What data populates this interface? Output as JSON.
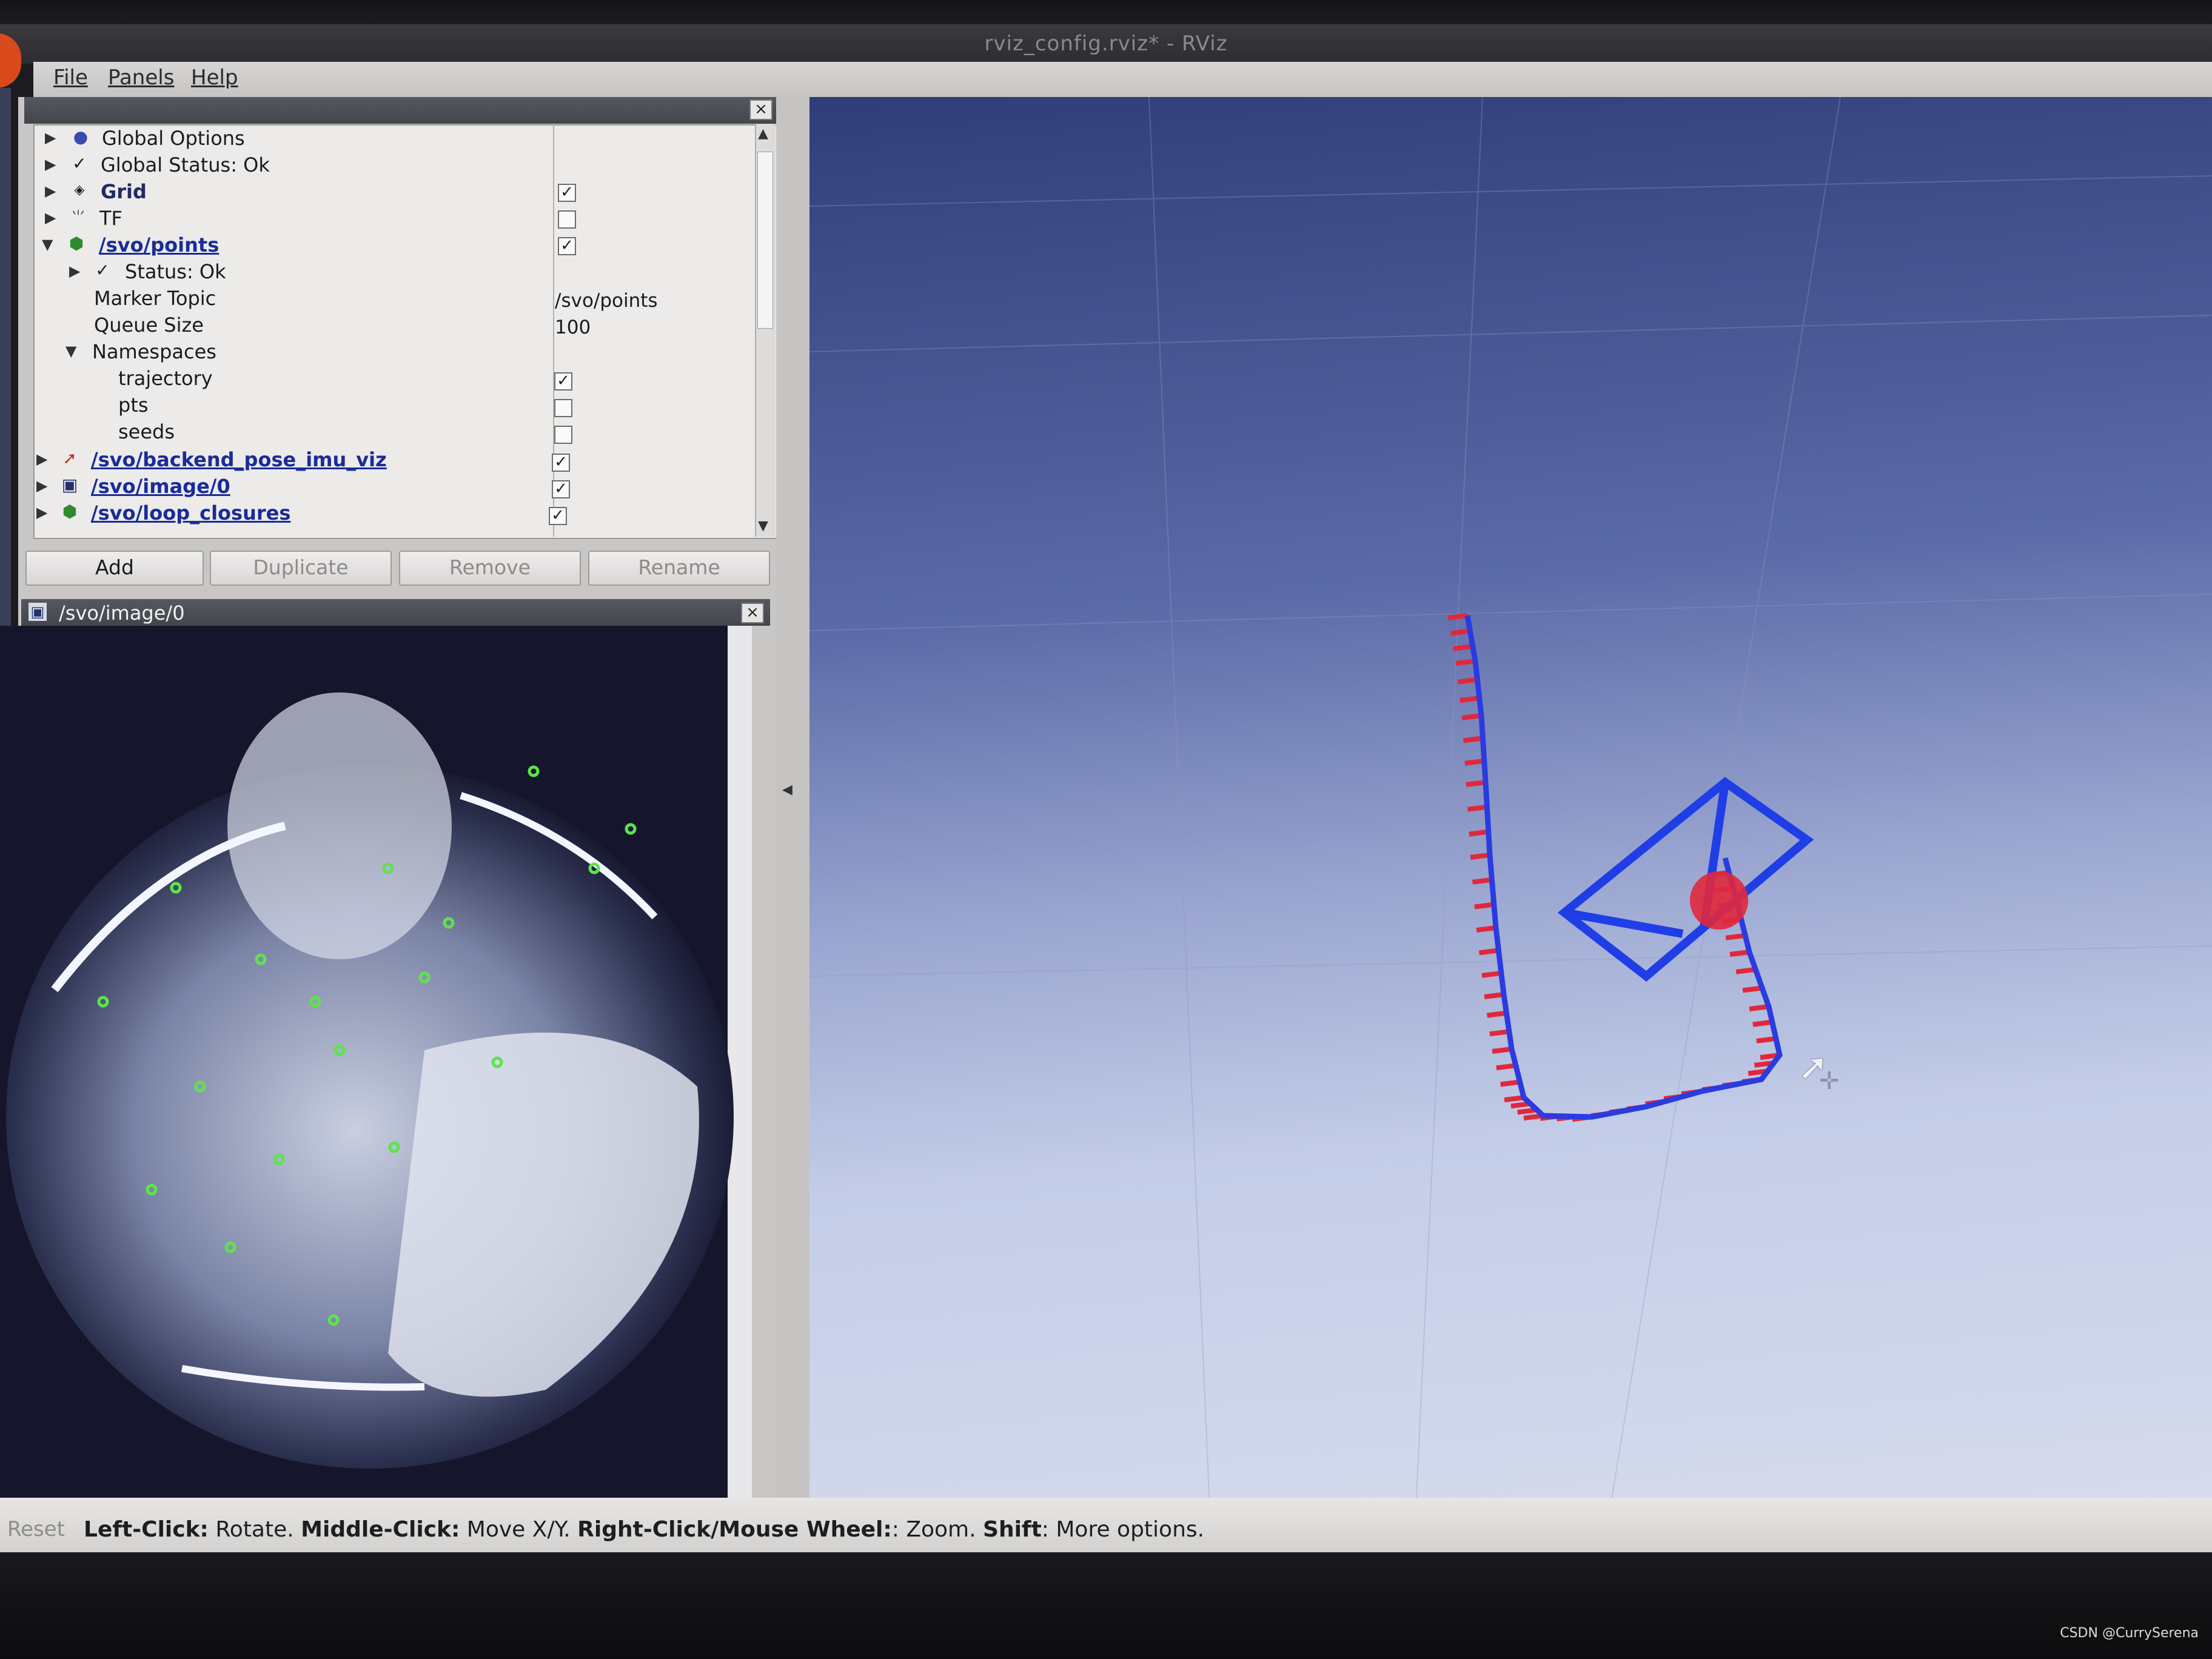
{
  "window": {
    "title": "rviz_config.rviz* - RViz"
  },
  "menubar": {
    "items": [
      "File",
      "Panels",
      "Help"
    ]
  },
  "displays_panel": {
    "close_glyph": "×",
    "rows": [
      {
        "label": "Global Options",
        "icon": "globe-icon",
        "kind": "normal"
      },
      {
        "label": "Global Status: Ok",
        "icon": "check-icon",
        "kind": "normal"
      },
      {
        "label": "Grid",
        "icon": "grid-icon",
        "kind": "bold",
        "checked": true
      },
      {
        "label": "TF",
        "icon": "tf-icon",
        "kind": "normal",
        "checked": false
      },
      {
        "label": "/svo/points",
        "icon": "marker-cube-icon",
        "kind": "topic",
        "checked": true
      },
      {
        "label": "Status: Ok",
        "icon": "check-icon",
        "kind": "normal"
      },
      {
        "label": "Marker Topic",
        "value": "/svo/points"
      },
      {
        "label": "Queue Size",
        "value": "100"
      },
      {
        "label": "Namespaces"
      },
      {
        "label": "trajectory",
        "checked": true
      },
      {
        "label": "pts",
        "checked": false
      },
      {
        "label": "seeds",
        "checked": false
      },
      {
        "label": "/svo/backend_pose_imu_viz",
        "icon": "pose-arrow-icon",
        "kind": "topic",
        "checked": true
      },
      {
        "label": "/svo/image/0",
        "icon": "image-icon",
        "kind": "topic",
        "checked": true
      },
      {
        "label": "/svo/loop_closures",
        "icon": "marker-cube-icon",
        "kind": "topic",
        "checked": true
      }
    ],
    "buttons": {
      "add": "Add",
      "duplicate": "Duplicate",
      "remove": "Remove",
      "rename": "Rename"
    }
  },
  "image_panel": {
    "title": "/svo/image/0",
    "close_glyph": "×"
  },
  "status_bar": {
    "reset": "Reset",
    "k1": "Left-Click:",
    "v1": " Rotate. ",
    "k2": "Middle-Click:",
    "v2": " Move X/Y. ",
    "k3": "Right-Click/Mouse Wheel:",
    "v3": ": Zoom. ",
    "k4": "Shift",
    "v4": ": More options."
  },
  "watermark": "CSDN @CurrySerena",
  "colors": {
    "trajectory": "#2a3be0",
    "pose_arrows": "#e0283c",
    "camera_frustum": "#1f3ee6",
    "features": "#55e04a"
  }
}
